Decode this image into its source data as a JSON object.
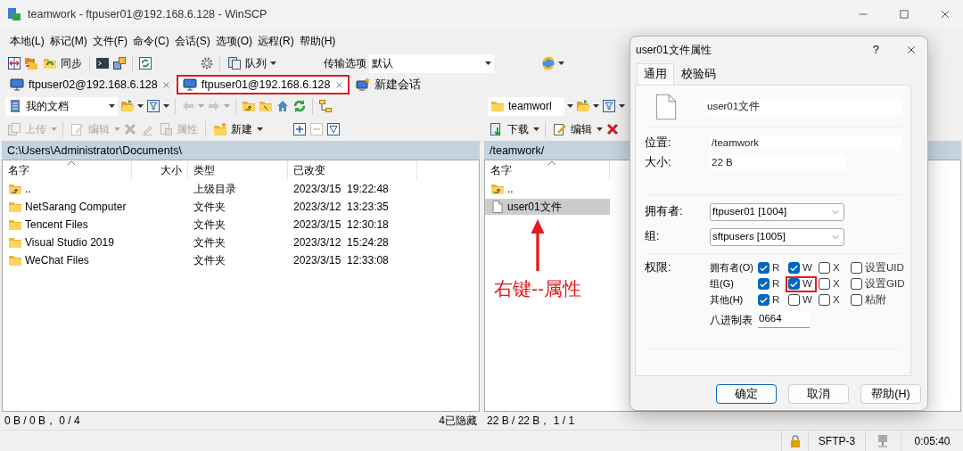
{
  "window": {
    "title": "teamwork - ftpuser01@192.168.6.128 - WinSCP"
  },
  "menu": [
    "本地(L)",
    "标记(M)",
    "文件(F)",
    "命令(C)",
    "会话(S)",
    "选项(O)",
    "远程(R)",
    "帮助(H)"
  ],
  "toolbar": {
    "sync_label": "同步",
    "queue_label": "队列",
    "transfer_label": "传输选项",
    "transfer_value": "默认"
  },
  "session_tabs": [
    {
      "kind": "session",
      "label": "ftpuser02@192.168.6.128",
      "selected": false,
      "highlighted": false
    },
    {
      "kind": "session",
      "label": "ftpuser01@192.168.6.128",
      "selected": true,
      "highlighted": true
    },
    {
      "kind": "new",
      "label": "新建会话",
      "selected": false,
      "highlighted": false
    }
  ],
  "left_panel": {
    "location": "我的文档",
    "buttons": [
      {
        "kind": "upload",
        "label": "上传",
        "disabled": true
      },
      {
        "kind": "edit",
        "label": "编辑",
        "disabled": true
      },
      {
        "kind": "properties",
        "label": "属性",
        "disabled": true
      },
      {
        "kind": "new",
        "label": "新建",
        "disabled": false
      }
    ],
    "path": "C:\\Users\\Administrator\\Documents\\",
    "columns": [
      "名字",
      "大小",
      "类型",
      "已改变"
    ],
    "rows": [
      {
        "kind": "parent",
        "name": "..",
        "type": "上级目录",
        "modified": "2023/3/15  19:22:48",
        "selected": false
      },
      {
        "kind": "folder",
        "name": "NetSarang Computer",
        "type": "文件夹",
        "modified": "2023/3/12  13:23:35",
        "selected": false
      },
      {
        "kind": "folder",
        "name": "Tencent Files",
        "type": "文件夹",
        "modified": "2023/3/15  12:30:18",
        "selected": false
      },
      {
        "kind": "folder",
        "name": "Visual Studio 2019",
        "type": "文件夹",
        "modified": "2023/3/12  15:24:28",
        "selected": false
      },
      {
        "kind": "folder",
        "name": "WeChat Files",
        "type": "文件夹",
        "modified": "2023/3/15  12:33:08",
        "selected": false
      }
    ],
    "status": "0 B / 0 B， 0 / 4",
    "hidden": "4已隐藏"
  },
  "right_panel": {
    "location": "teamworl",
    "buttons": [
      {
        "kind": "download",
        "label": "下载",
        "disabled": false
      },
      {
        "kind": "edit",
        "label": "编辑",
        "disabled": false
      }
    ],
    "path": "/teamwork/",
    "columns": [
      "名字"
    ],
    "rows": [
      {
        "kind": "parent",
        "name": "..",
        "selected": false
      },
      {
        "kind": "file",
        "name": "user01文件",
        "selected": true
      }
    ],
    "status": "22 B / 22 B， 1 / 1"
  },
  "annotation": {
    "text": "右键--属性"
  },
  "status_bar": {
    "protocol": "SFTP-3",
    "elapsed": "0:05:40"
  },
  "dialog": {
    "title": "user01文件属性",
    "help": "?",
    "tabs": [
      {
        "label": "通用",
        "selected": true
      },
      {
        "label": "校验码",
        "selected": false
      }
    ],
    "file_name": "user01文件",
    "fields": [
      {
        "label": "位置:",
        "value": "/teamwork"
      },
      {
        "label": "大小:",
        "value": "22 B"
      }
    ],
    "combos": [
      {
        "label": "拥有者:",
        "value": "ftpuser01 [1004]"
      },
      {
        "label": "组:",
        "value": "sftpusers [1005]"
      }
    ],
    "permissions_label": "权限:",
    "permissions": [
      {
        "label": "拥有者(O)",
        "bits": [
          {
            "label": "R",
            "checked": true,
            "highlighted": false
          },
          {
            "label": "W",
            "checked": true,
            "highlighted": false
          },
          {
            "label": "X",
            "checked": false,
            "highlighted": false
          },
          {
            "label": "设置UID",
            "checked": false,
            "highlighted": false
          }
        ]
      },
      {
        "label": "组(G)",
        "bits": [
          {
            "label": "R",
            "checked": true,
            "highlighted": false
          },
          {
            "label": "W",
            "checked": true,
            "highlighted": true
          },
          {
            "label": "X",
            "checked": false,
            "highlighted": false
          },
          {
            "label": "设置GID",
            "checked": false,
            "highlighted": false
          }
        ]
      },
      {
        "label": "其他(H)",
        "bits": [
          {
            "label": "R",
            "checked": true,
            "highlighted": false
          },
          {
            "label": "W",
            "checked": false,
            "highlighted": false
          },
          {
            "label": "X",
            "checked": false,
            "highlighted": false
          },
          {
            "label": "粘附",
            "checked": false,
            "highlighted": false
          }
        ]
      }
    ],
    "octal": {
      "label": "八进制表",
      "value": "0664"
    },
    "buttons": [
      {
        "label": "确定",
        "default": true
      },
      {
        "label": "取消",
        "default": false
      },
      {
        "label": "帮助(H)",
        "default": false
      }
    ]
  }
}
